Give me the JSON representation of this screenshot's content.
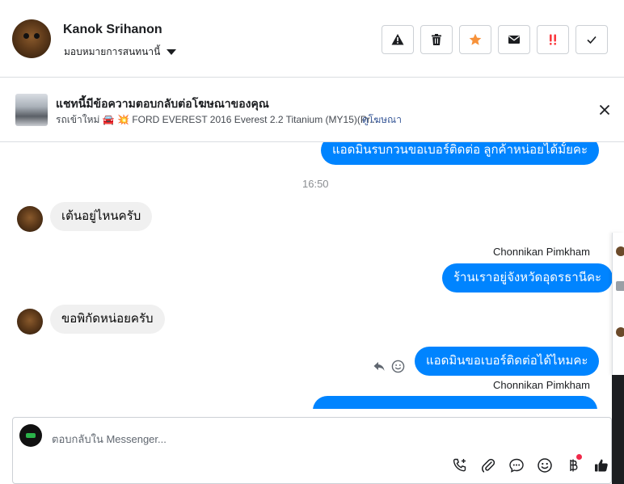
{
  "header": {
    "contact_name": "Kanok Srihanon",
    "assign_label": "มอบหมายการสนทนานี้",
    "actions": [
      {
        "name": "mark-spam-button",
        "icon": "warning-icon",
        "color": "#1c1e21"
      },
      {
        "name": "delete-button",
        "icon": "trash-icon",
        "color": "#1c1e21"
      },
      {
        "name": "star-button",
        "icon": "star-icon",
        "color": "#f7923a"
      },
      {
        "name": "mark-unread-button",
        "icon": "envelope-icon",
        "color": "#1c1e21"
      },
      {
        "name": "follow-up-button",
        "icon": "double-exclamation-icon",
        "color": "#fa383e"
      },
      {
        "name": "mark-done-button",
        "icon": "checkmark-icon",
        "color": "#1c1e21"
      }
    ]
  },
  "ad": {
    "title": "แชทนี้มีข้อความตอบกลับต่อโฆษณาของคุณ",
    "subtitle": "รถเข้าใหม่ 🚘 💥  FORD EVEREST 2016 Everest 2.2 Titanium (MY15)(Pr...",
    "link": "ดูโฆษณา"
  },
  "messages": [
    {
      "text": "แอดมินรบกวนขอเบอร์ติดต่อ ลูกค้าหน่อยได้มั้ยคะ"
    },
    {
      "text": "16:50"
    },
    {
      "text": "เต้นอยู่ไหนครับ"
    },
    {
      "text": "Chonnikan Pimkham"
    },
    {
      "text": "ร้านเราอยู่จังหวัดอุดรธานีคะ"
    },
    {
      "text": "ขอพิกัดหน่อยครับ"
    },
    {
      "text": "แอดมินขอเบอร์ติดต่อได้ไหมคะ"
    },
    {
      "text": "Chonnikan Pimkham"
    }
  ],
  "composer": {
    "placeholder": "ตอบกลับใน Messenger..."
  },
  "colors": {
    "accent": "#0084ff",
    "incoming_bubble": "#f0f0f0"
  }
}
